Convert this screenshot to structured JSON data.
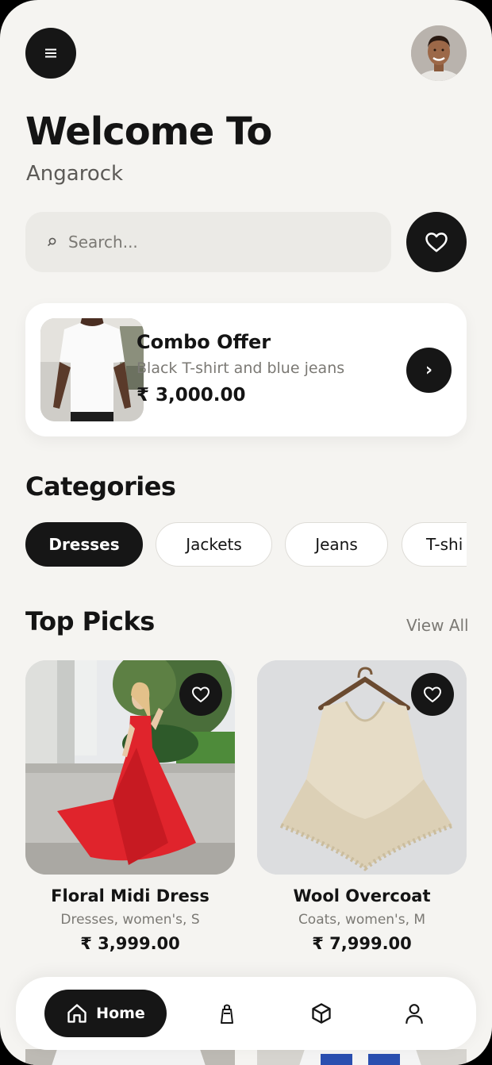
{
  "header": {
    "title": "Welcome To",
    "subtitle": "Angarock"
  },
  "search": {
    "placeholder": "Search..."
  },
  "combo": {
    "title": "Combo Offer",
    "description": "Black T-shirt and blue jeans",
    "price": "₹ 3,000.00"
  },
  "categories": {
    "title": "Categories",
    "items": [
      "Dresses",
      "Jackets",
      "Jeans",
      "T-shi"
    ]
  },
  "top_picks": {
    "title": "Top Picks",
    "view_all": "View All",
    "products": [
      {
        "name": "Floral Midi Dress",
        "meta": "Dresses, women's, S",
        "price": "₹ 3,999.00"
      },
      {
        "name": "Wool Overcoat",
        "meta": "Coats, women's, M",
        "price": "₹ 7,999.00"
      }
    ]
  },
  "nav": {
    "home_label": "Home"
  },
  "colors": {
    "background": "#f5f4f1",
    "dark": "#161616",
    "muted": "#7b7974",
    "accent_red": "#e0242c"
  }
}
